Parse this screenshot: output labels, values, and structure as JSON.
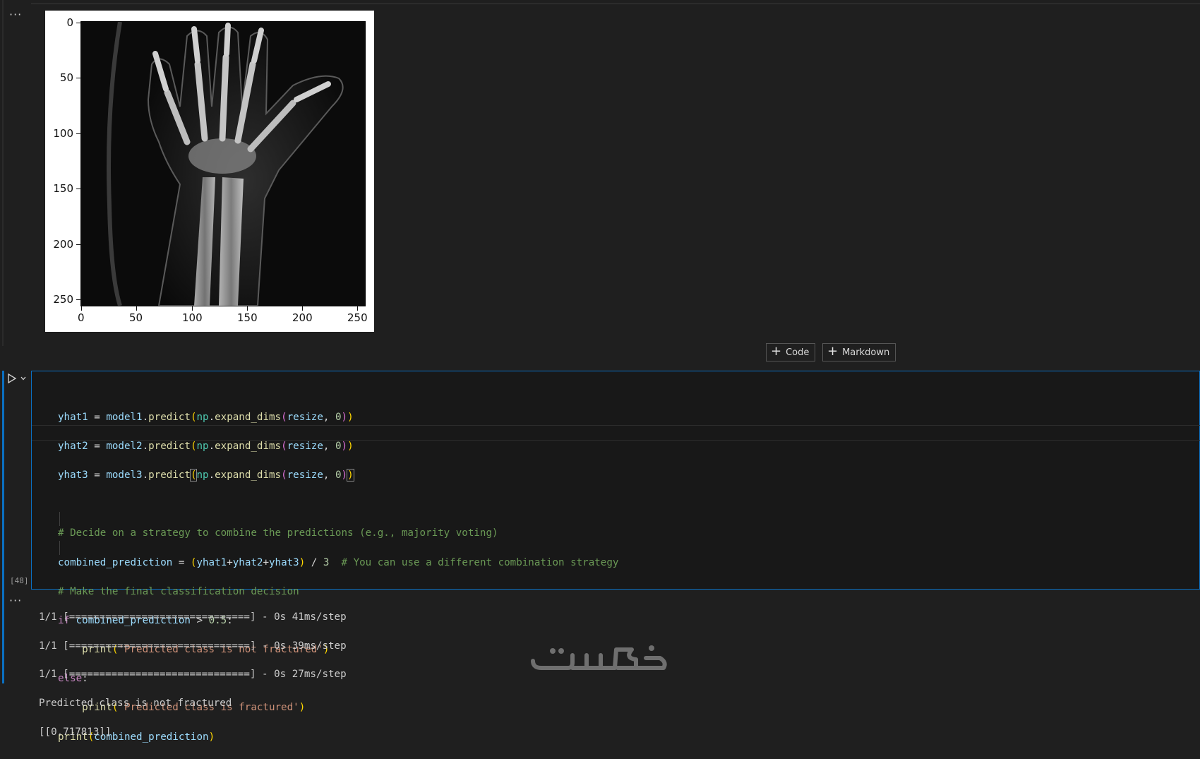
{
  "plot": {
    "y_ticks": [
      "0",
      "50",
      "100",
      "150",
      "200",
      "250"
    ],
    "x_ticks": [
      "0",
      "50",
      "100",
      "150",
      "200",
      "250"
    ]
  },
  "buttons": {
    "code_label": "Code",
    "markdown_label": "Markdown"
  },
  "cell": {
    "execution_count": "[48]",
    "code_lines": [
      "yhat1 = model1.predict(np.expand_dims(resize, 0))",
      "yhat2 = model2.predict(np.expand_dims(resize, 0))",
      "yhat3 = model3.predict(np.expand_dims(resize, 0))",
      "",
      "# Decide on a strategy to combine the predictions (e.g., majority voting)",
      "combined_prediction = (yhat1+yhat2+yhat3) / 3  # You can use a different combination strategy",
      "# Make the final classification decision",
      "if combined_prediction > 0.5:",
      "    print('Predicted class is not fractured')",
      "else:",
      "    print('Predicted class is fractured')",
      "print(combined_prediction)"
    ]
  },
  "output": {
    "lines": [
      "1/1 [==============================] - 0s 41ms/step",
      "1/1 [==============================] - 0s 39ms/step",
      "1/1 [==============================] - 0s 27ms/step",
      "Predicted class is not fractured",
      "[[0.717813]]"
    ]
  },
  "watermark": {
    "text": "خمسات"
  },
  "colors": {
    "accent": "#0a6fc2",
    "background": "#1f1f1f",
    "cell_background": "#181818"
  },
  "icons": [
    "more-actions-icon",
    "run-cell-icon",
    "chevron-down-icon",
    "plus-icon"
  ]
}
